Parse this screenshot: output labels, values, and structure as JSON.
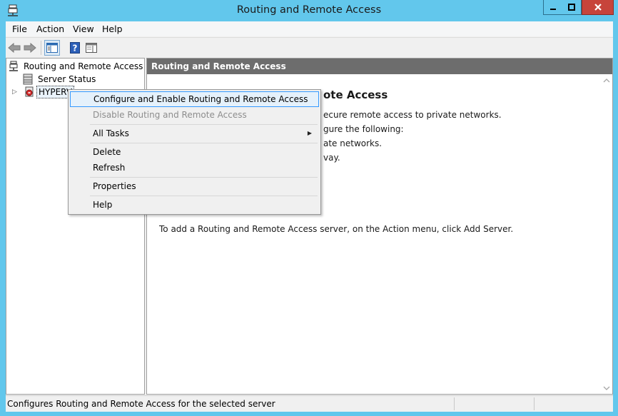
{
  "window": {
    "title": "Routing and Remote Access"
  },
  "menubar": {
    "items": [
      "File",
      "Action",
      "View",
      "Help"
    ]
  },
  "toolbar": {
    "buttons": [
      "back-icon",
      "forward-icon",
      "show-hide-console-tree-icon",
      "help-icon",
      "show-hide-action-pane-icon"
    ]
  },
  "tree": {
    "root_label": "Routing and Remote Access",
    "server_status_label": "Server Status",
    "server_label": "HYPERV"
  },
  "right_pane": {
    "header": "Routing and Remote Access",
    "heading_fragment": "ote Access",
    "line1_fragment": "ecure remote access to private networks.",
    "line2_fragment": "gure the following:",
    "line3_fragment": "ate networks.",
    "line4_fragment": "vay.",
    "add_server_text": "To add a Routing and Remote Access server, on the Action menu, click Add Server."
  },
  "context_menu": {
    "configure": "Configure and Enable Routing and Remote Access",
    "disable": "Disable Routing and Remote Access",
    "all_tasks": "All Tasks",
    "delete": "Delete",
    "refresh": "Refresh",
    "properties": "Properties",
    "help": "Help"
  },
  "statusbar": {
    "text": "Configures Routing and Remote Access for the selected server"
  },
  "colors": {
    "title_bar": "#62c7ec",
    "close_button": "#c7443b",
    "pane_header": "#6d6d6d",
    "highlight": "#e5f1fb",
    "highlight_border": "#3399ff"
  }
}
